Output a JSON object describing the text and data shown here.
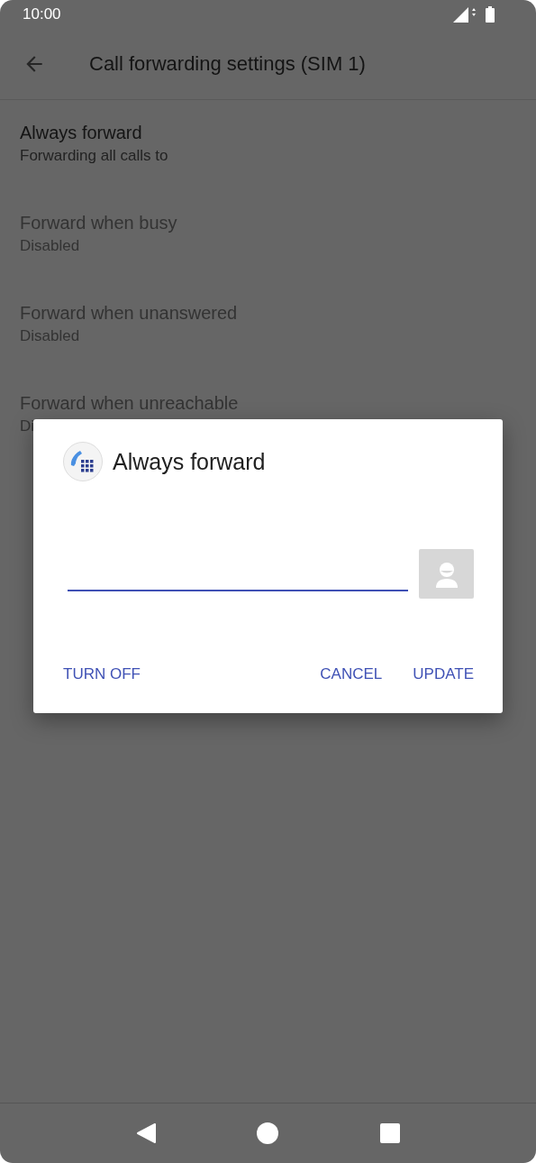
{
  "status_bar": {
    "time": "10:00"
  },
  "toolbar": {
    "title": "Call forwarding settings (SIM 1)"
  },
  "settings": [
    {
      "title": "Always forward",
      "summary": "Forwarding all calls to",
      "disabled": false
    },
    {
      "title": "Forward when busy",
      "summary": "Disabled",
      "disabled": true
    },
    {
      "title": "Forward when unanswered",
      "summary": "Disabled",
      "disabled": true
    },
    {
      "title": "Forward when unreachable",
      "summary": "Di",
      "disabled": true
    }
  ],
  "dialog": {
    "title": "Always forward",
    "buttons": [
      {
        "label": "TURN OFF",
        "kind": "left"
      },
      {
        "label": "CANCEL",
        "kind": "right"
      },
      {
        "label": "UPDATE",
        "kind": "right"
      }
    ]
  }
}
